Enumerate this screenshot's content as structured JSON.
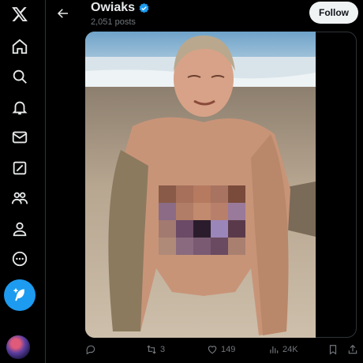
{
  "header": {
    "title": "Owiaks",
    "subtitle": "2,051 posts",
    "follow_label": "Follow"
  },
  "sidebar": {
    "items": [
      {
        "icon": "x-logo-icon"
      },
      {
        "icon": "home-icon"
      },
      {
        "icon": "search-icon"
      },
      {
        "icon": "bell-icon"
      },
      {
        "icon": "mail-icon"
      },
      {
        "icon": "grok-icon"
      },
      {
        "icon": "communities-icon"
      },
      {
        "icon": "profile-icon"
      },
      {
        "icon": "more-icon"
      }
    ],
    "compose_icon": "feather-plus-icon"
  },
  "actions": {
    "reply_count": "",
    "repost_count": "3",
    "like_count": "149",
    "views_count": "24K"
  },
  "colors": {
    "accent": "#1d9bf0",
    "background": "#000000",
    "muted_text": "#71767b"
  }
}
